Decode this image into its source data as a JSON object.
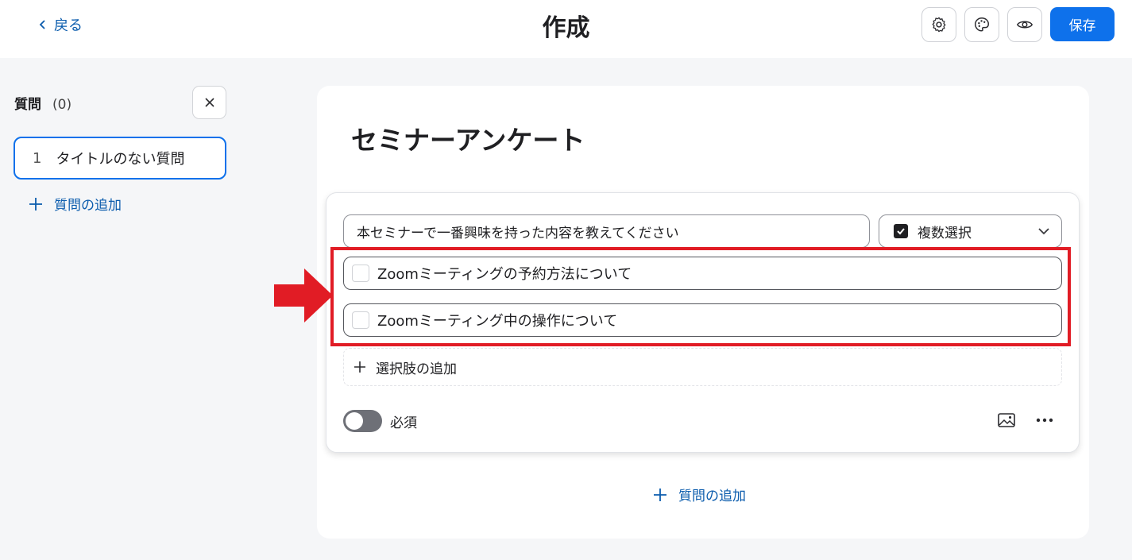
{
  "header": {
    "back_label": "戻る",
    "title": "作成",
    "icons": [
      "gear-icon",
      "palette-icon",
      "eye-icon"
    ],
    "save_label": "保存"
  },
  "sidebar": {
    "heading": "質問",
    "count": "(0)",
    "items": [
      {
        "number": "1",
        "label": "タイトルのない質問"
      }
    ],
    "add_label": "質問の追加"
  },
  "survey": {
    "title": "セミナーアンケート",
    "question": {
      "text": "本セミナーで一番興味を持った内容を教えてください",
      "type_label": "複数選択",
      "options": [
        "Zoomミーティングの予約方法について",
        "Zoomミーティング中の操作について"
      ],
      "add_choice_label": "選択肢の追加",
      "required_label": "必須",
      "required": false
    },
    "add_question_label": "質問の追加"
  },
  "colors": {
    "accent": "#0e71eb",
    "link": "#0b5cad",
    "highlight": "#e11c25"
  }
}
